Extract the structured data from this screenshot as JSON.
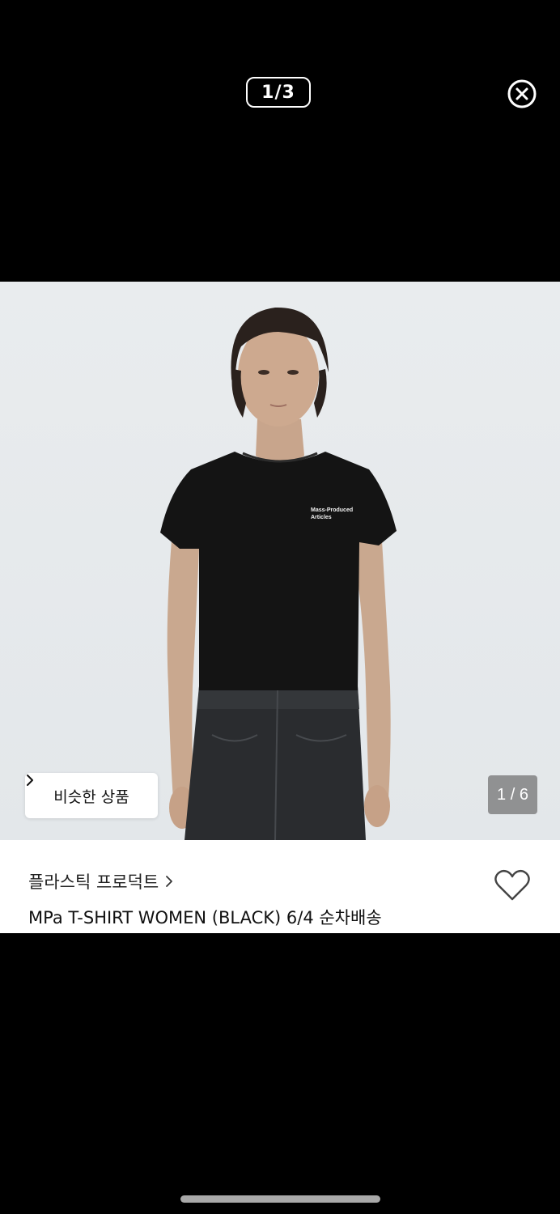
{
  "viewer": {
    "counter": "1/3",
    "close_icon": "close-circle-icon"
  },
  "photo": {
    "shirt_print": "Mass-Produced Articles",
    "counter": "1 / 6"
  },
  "similar": {
    "label": "비슷한 상품",
    "icon": "chevron-right-icon"
  },
  "product": {
    "brand": "플라스틱 프로덕트",
    "brand_icon": "chevron-right-icon",
    "name": "MPa T-SHIRT WOMEN (BLACK) 6/4 순차배송",
    "wishlist_icon": "heart-outline-icon"
  },
  "colors": {
    "background": "#000000",
    "card": "#ffffff",
    "shirt": "#141414"
  }
}
